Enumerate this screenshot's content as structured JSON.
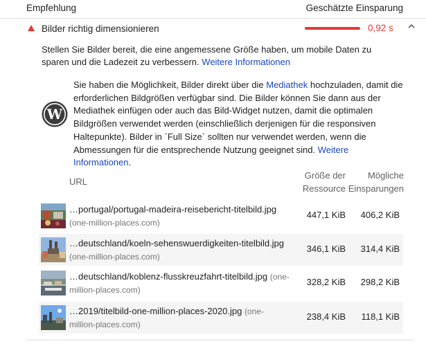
{
  "header": {
    "left_label": "Empfehlung",
    "right_label": "Geschätzte Einsparung"
  },
  "audit": {
    "title": "Bilder richtig dimensionieren",
    "saving": "0,92 s",
    "status_color": "#e53935",
    "icon": "warning-triangle-icon",
    "expanded": true
  },
  "description": {
    "text": "Stellen Sie Bilder bereit, die eine angemessene Größe haben, um mobile Daten zu sparen und die Ladezeit zu verbessern.",
    "link": "Weitere Informationen"
  },
  "wordpress": {
    "icon": "wordpress-logo-icon",
    "text_1": "Sie haben die Möglichkeit, Bilder direkt über die",
    "link_1": "Mediathek",
    "text_2": "hochzuladen, damit die erforderlichen Bildgrößen verfügbar sind. Die Bilder können Sie dann aus der Mediathek einfügen oder auch das Bild-Widget nutzen, damit die optimalen Bildgrößen verwendet werden (einschließlich derjenigen für die responsiven Haltepunkte). Bilder in `Full Size` sollten nur verwendet werden, wenn die Abmessungen für die entsprechende Nutzung geeignet sind.",
    "link_2": "Weitere Informationen",
    "text_end": "."
  },
  "table": {
    "col_url": "URL",
    "col_size": "Größe der Ressource",
    "col_saving": "Mögliche Einsparungen",
    "rows": [
      {
        "path": "…portugal/portugal-madeira-reisebericht-titelbild.jpg",
        "host": "(one-million-places.com)",
        "size": "447,1 KiB",
        "saving": "406,2 KiB"
      },
      {
        "path": "…deutschland/koeln-sehenswuerdigkeiten-titelbild.jpg",
        "host": "(one-million-places.com)",
        "size": "346,1 KiB",
        "saving": "314,4 KiB"
      },
      {
        "path": "…deutschland/koblenz-flusskreuzfahrt-titelbild.jpg",
        "host": "(one-million-places.com)",
        "size": "328,2 KiB",
        "saving": "298,2 KiB"
      },
      {
        "path": "…2019/titelbild-one-million-places-2020.jpg",
        "host": "(one-million-places.com)",
        "size": "238,4 KiB",
        "saving": "118,1 KiB"
      }
    ]
  }
}
